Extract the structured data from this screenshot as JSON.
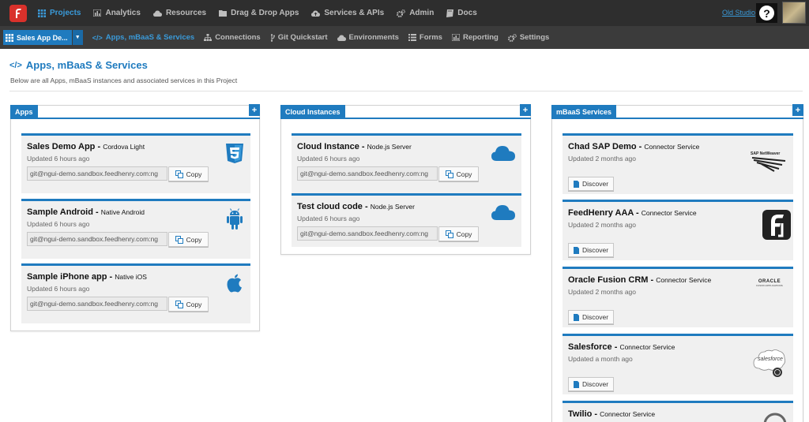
{
  "colors": {
    "accent": "#1f7bbf",
    "topbar": "#2e2e2e",
    "subbar": "#3b3b3b",
    "brand": "#d9312b"
  },
  "topnav": {
    "items": [
      {
        "label": "Projects",
        "icon": "grid-icon"
      },
      {
        "label": "Analytics",
        "icon": "chart-icon"
      },
      {
        "label": "Resources",
        "icon": "cloud-icon"
      },
      {
        "label": "Drag & Drop Apps",
        "icon": "folder-icon"
      },
      {
        "label": "Services & APIs",
        "icon": "cloud-upload-icon"
      },
      {
        "label": "Admin",
        "icon": "gears-icon"
      },
      {
        "label": "Docs",
        "icon": "book-icon"
      }
    ],
    "old_studio": "Old Studio",
    "help": "?"
  },
  "subnav": {
    "project": "Sales App De...",
    "items": [
      {
        "label": "Apps, mBaaS & Services",
        "icon": "code-icon"
      },
      {
        "label": "Connections",
        "icon": "sitemap-icon"
      },
      {
        "label": "Git Quickstart",
        "icon": "git-icon"
      },
      {
        "label": "Environments",
        "icon": "cloud-icon"
      },
      {
        "label": "Forms",
        "icon": "list-icon"
      },
      {
        "label": "Reporting",
        "icon": "chart-icon"
      },
      {
        "label": "Settings",
        "icon": "gears-icon"
      }
    ]
  },
  "page": {
    "title_icon": "</>",
    "title": "Apps, mBaaS & Services",
    "subtitle": "Below are all Apps, mBaaS instances and associated services in this Project"
  },
  "apps": {
    "header": "Apps",
    "add": "+",
    "items": [
      {
        "name": "Sales Demo App",
        "sep": " - ",
        "type": "Cordova Light",
        "updated": "Updated 6 hours ago",
        "git": "git@ngui-demo.sandbox.feedhenry.com:ng",
        "copy": "Copy",
        "icon": "html5-icon"
      },
      {
        "name": "Sample Android",
        "sep": " - ",
        "type": "Native Android",
        "updated": "Updated 6 hours ago",
        "git": "git@ngui-demo.sandbox.feedhenry.com:ng",
        "copy": "Copy",
        "icon": "android-icon"
      },
      {
        "name": "Sample iPhone app",
        "sep": " - ",
        "type": "Native iOS",
        "updated": "Updated 6 hours ago",
        "git": "git@ngui-demo.sandbox.feedhenry.com:ng",
        "copy": "Copy",
        "icon": "apple-icon"
      }
    ]
  },
  "cloud": {
    "header": "Cloud Instances",
    "add": "+",
    "items": [
      {
        "name": "Cloud Instance",
        "sep": " - ",
        "type": "Node.js Server",
        "updated": "Updated 6 hours ago",
        "git": "git@ngui-demo.sandbox.feedhenry.com:ng",
        "copy": "Copy",
        "icon": "cloud-icon"
      },
      {
        "name": "Test cloud code",
        "sep": " - ",
        "type": "Node.js Server",
        "updated": "Updated 6 hours ago",
        "git": "git@ngui-demo.sandbox.feedhenry.com:ng",
        "copy": "Copy",
        "icon": "cloud-icon"
      }
    ]
  },
  "mbaas": {
    "header": "mBaaS Services",
    "add": "+",
    "items": [
      {
        "name": "Chad SAP Demo",
        "sep": " - ",
        "type": "Connector Service",
        "updated": "Updated 2 months ago",
        "discover": "Discover",
        "logo_text": "SAP NetWeaver",
        "icon": "sap-netweaver-logo"
      },
      {
        "name": "FeedHenry AAA",
        "sep": " - ",
        "type": "Connector Service",
        "updated": "Updated 2 months ago",
        "discover": "Discover",
        "icon": "feedhenry-logo"
      },
      {
        "name": "Oracle Fusion CRM",
        "sep": " - ",
        "type": "Connector Service",
        "updated": "Updated 2 months ago",
        "discover": "Discover",
        "logo_text": "ORACLE",
        "logo_sub": "FUSION APPLICATIONS",
        "icon": "oracle-fusion-logo"
      },
      {
        "name": "Salesforce",
        "sep": " - ",
        "type": "Connector Service",
        "updated": "Updated a month ago",
        "discover": "Discover",
        "logo_text": "salesforce",
        "icon": "salesforce-logo"
      },
      {
        "name": "Twilio",
        "sep": " - ",
        "type": "Connector Service",
        "icon": "twilio-logo"
      }
    ]
  }
}
